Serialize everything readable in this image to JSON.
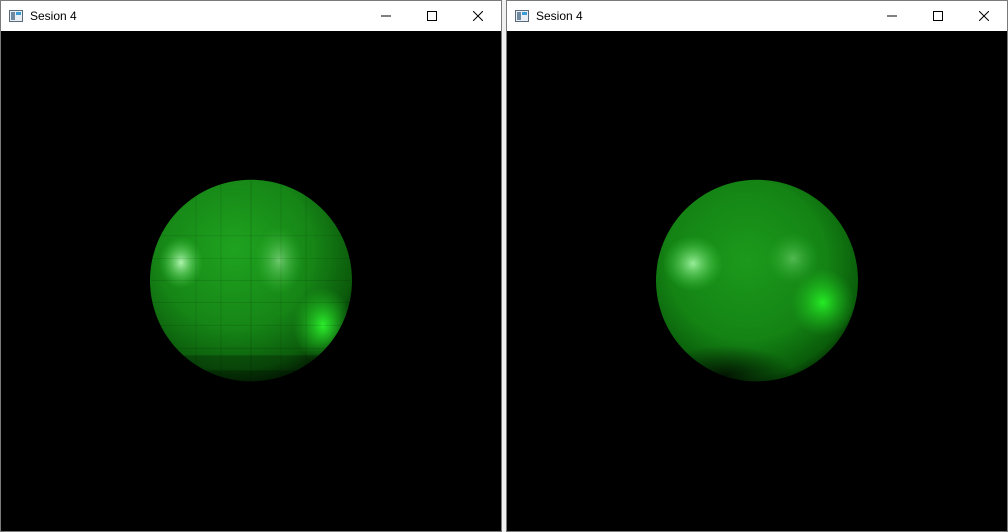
{
  "windows": [
    {
      "title": "Sesion 4",
      "shading": "flat",
      "controls": [
        "minimize-icon",
        "maximize-icon",
        "close-icon"
      ]
    },
    {
      "title": "Sesion 4",
      "shading": "smooth",
      "controls": [
        "minimize-icon",
        "maximize-icon",
        "close-icon"
      ]
    }
  ],
  "colors": {
    "background": "#000000",
    "sphere_base": "#1a8c1a",
    "sphere_dark": "#003300",
    "specular": "#b8ffb8",
    "titlebar": "#ffffff"
  }
}
